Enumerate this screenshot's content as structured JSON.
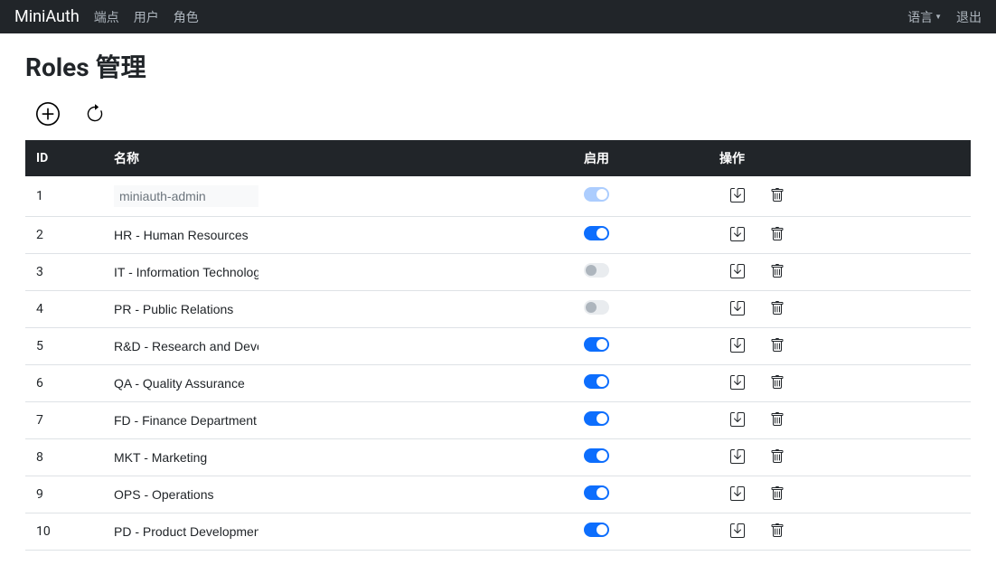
{
  "navbar": {
    "brand": "MiniAuth",
    "links": [
      "端点",
      "用户",
      "角色"
    ],
    "language_label": "语言",
    "logout_label": "退出"
  },
  "page": {
    "title": "Roles 管理"
  },
  "table": {
    "headers": {
      "id": "ID",
      "name": "名称",
      "enable": "启用",
      "actions": "操作"
    },
    "rows": [
      {
        "id": "1",
        "name": "miniauth-admin",
        "enabled": true,
        "readonly": true
      },
      {
        "id": "2",
        "name": "HR - Human Resources",
        "enabled": true,
        "readonly": false
      },
      {
        "id": "3",
        "name": "IT - Information Technology",
        "enabled": false,
        "readonly": false
      },
      {
        "id": "4",
        "name": "PR - Public Relations",
        "enabled": false,
        "readonly": false
      },
      {
        "id": "5",
        "name": "R&D - Research and Development",
        "enabled": true,
        "readonly": false
      },
      {
        "id": "6",
        "name": "QA - Quality Assurance",
        "enabled": true,
        "readonly": false
      },
      {
        "id": "7",
        "name": "FD - Finance Department",
        "enabled": true,
        "readonly": false
      },
      {
        "id": "8",
        "name": "MKT - Marketing",
        "enabled": true,
        "readonly": false
      },
      {
        "id": "9",
        "name": "OPS - Operations",
        "enabled": true,
        "readonly": false
      },
      {
        "id": "10",
        "name": "PD - Product Development",
        "enabled": true,
        "readonly": false
      }
    ]
  }
}
